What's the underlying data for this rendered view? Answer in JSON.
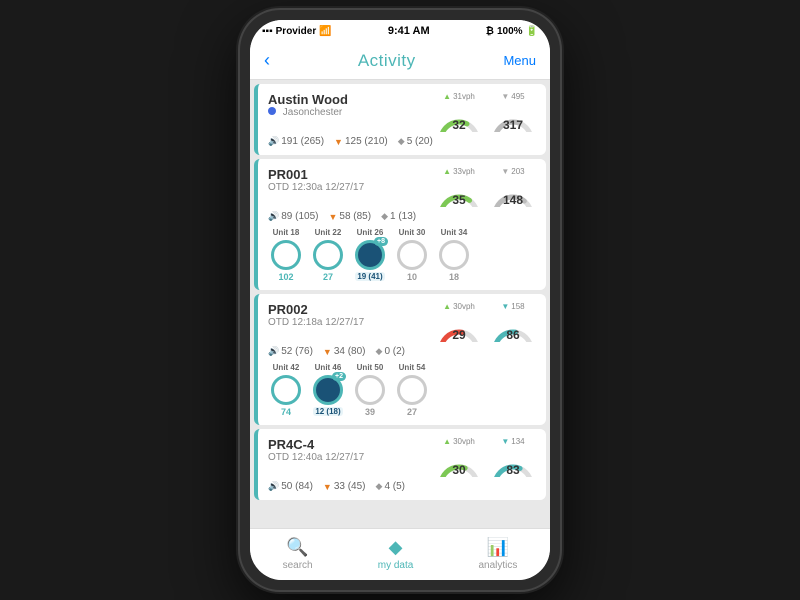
{
  "statusBar": {
    "provider": "Provider",
    "time": "9:41 AM",
    "battery": "100%"
  },
  "navBar": {
    "back": "‹",
    "title": "Activity",
    "menu": "Menu"
  },
  "cards": [
    {
      "id": "austin-wood",
      "title": "Austin Wood",
      "subtitle": "Jasonchester",
      "dotColor": "#4169e1",
      "gauge1": {
        "label": "31vph",
        "value": "32",
        "color": "#7dc855",
        "pct": 65
      },
      "gauge2": {
        "label": "495",
        "value": "317",
        "color": "#aaa",
        "pct": 60
      },
      "stats": [
        {
          "icon": "vol",
          "val": "191 (265)"
        },
        {
          "icon": "dn",
          "val": "125 (210)"
        },
        {
          "icon": "dia",
          "val": "5 (20)"
        }
      ],
      "units": []
    },
    {
      "id": "pr001",
      "title": "PR001",
      "subtitle": "OTD 12:30a 12/27/17",
      "gauge1": {
        "label": "33vph",
        "value": "35",
        "color": "#7dc855",
        "pct": 70
      },
      "gauge2": {
        "label": "203",
        "value": "148",
        "color": "#aaa",
        "pct": 72
      },
      "stats": [
        {
          "icon": "vol",
          "val": "89 (105)"
        },
        {
          "icon": "dn",
          "val": "58 (85)"
        },
        {
          "icon": "dia",
          "val": "1 (13)"
        }
      ],
      "units": [
        {
          "label": "Unit 18",
          "value": "102",
          "active": false,
          "badge": null
        },
        {
          "label": "Unit 22",
          "value": "27",
          "active": false,
          "badge": null
        },
        {
          "label": "Unit 26",
          "value": "19 (41)",
          "active": true,
          "badge": "+8"
        },
        {
          "label": "Unit 30",
          "value": "10",
          "active": false,
          "badge": null
        },
        {
          "label": "Unit 34",
          "value": "18",
          "active": false,
          "badge": null
        }
      ]
    },
    {
      "id": "pr002",
      "title": "PR002",
      "subtitle": "OTD 12:18a 12/27/17",
      "gauge1": {
        "label": "30vph",
        "value": "29",
        "color": "#e74c3c",
        "pct": 55
      },
      "gauge2": {
        "label": "158",
        "value": "86",
        "color": "#4db6b6",
        "pct": 54
      },
      "stats": [
        {
          "icon": "vol",
          "val": "52 (76)"
        },
        {
          "icon": "dn",
          "val": "34 (80)"
        },
        {
          "icon": "dia",
          "val": "0 (2)"
        }
      ],
      "units": [
        {
          "label": "Unit 42",
          "value": "74",
          "active": false,
          "badge": null
        },
        {
          "label": "Unit 46",
          "value": "12 (18)",
          "active": true,
          "badge": "+2"
        },
        {
          "label": "Unit 50",
          "value": "39",
          "active": false,
          "badge": null
        },
        {
          "label": "Unit 54",
          "value": "27",
          "active": false,
          "badge": null
        }
      ]
    },
    {
      "id": "pr4c4",
      "title": "PR4C-4",
      "subtitle": "OTD 12:40a 12/27/17",
      "gauge1": {
        "label": "30vph",
        "value": "30",
        "color": "#7dc855",
        "pct": 60
      },
      "gauge2": {
        "label": "134",
        "value": "83",
        "color": "#4db6b6",
        "pct": 62
      },
      "stats": [
        {
          "icon": "vol",
          "val": "50 (84)"
        },
        {
          "icon": "dn",
          "val": "33 (45)"
        },
        {
          "icon": "dia",
          "val": "4 (5)"
        }
      ],
      "units": []
    }
  ],
  "bottomNav": [
    {
      "label": "search",
      "icon": "🔍",
      "active": false
    },
    {
      "label": "my data",
      "icon": "◆",
      "active": true
    },
    {
      "label": "analytics",
      "icon": "📊",
      "active": false
    }
  ]
}
